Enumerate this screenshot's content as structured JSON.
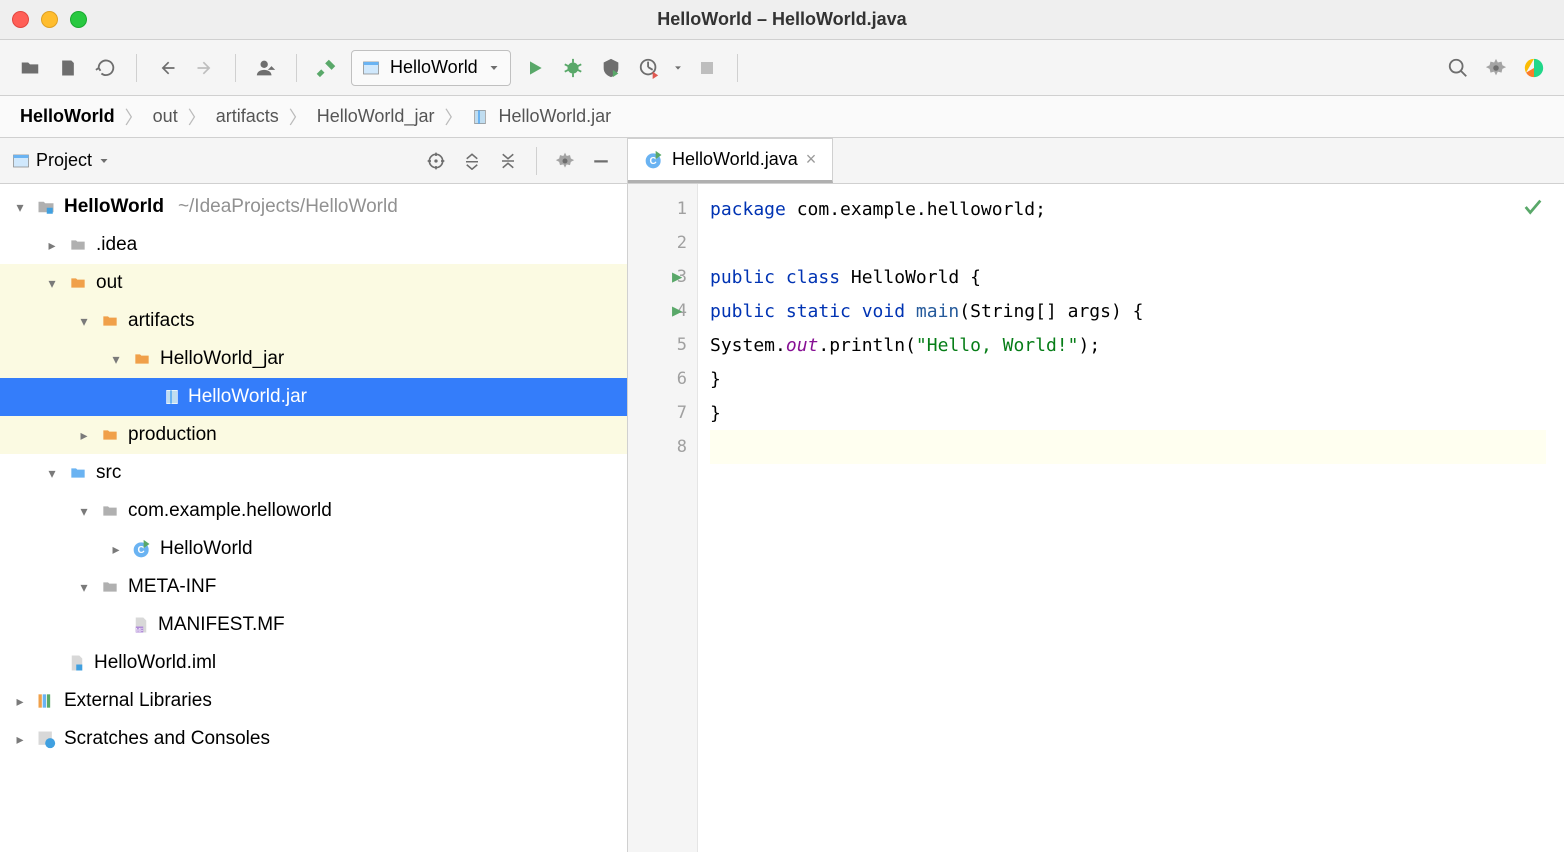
{
  "window": {
    "title": "HelloWorld – HelloWorld.java"
  },
  "toolbar": {
    "run_config": "HelloWorld"
  },
  "breadcrumbs": [
    "HelloWorld",
    "out",
    "artifacts",
    "HelloWorld_jar",
    "HelloWorld.jar"
  ],
  "sidebar": {
    "view_label": "Project"
  },
  "tree": {
    "project": {
      "name": "HelloWorld",
      "path": "~/IdeaProjects/HelloWorld"
    },
    "idea": ".idea",
    "out": "out",
    "artifacts": "artifacts",
    "hw_jar": "HelloWorld_jar",
    "jar": "HelloWorld.jar",
    "production": "production",
    "src": "src",
    "pkg": "com.example.helloworld",
    "cls": "HelloWorld",
    "metainf": "META-INF",
    "manifest": "MANIFEST.MF",
    "iml": "HelloWorld.iml",
    "ext": "External Libraries",
    "scratches": "Scratches and Consoles"
  },
  "editor": {
    "tab": "HelloWorld.java",
    "lines": [
      "1",
      "2",
      "3",
      "4",
      "5",
      "6",
      "7",
      "8"
    ],
    "code": {
      "l1_kw": "package ",
      "l1_id": "com.example.helloworld;",
      "l3_pub": "public class ",
      "l3_cls": "HelloWorld {",
      "l4_pub": "public static void ",
      "l4_main": "main",
      "l4_args": "(String[] args) {",
      "l5_sys": "System.",
      "l5_out": "out",
      "l5_println": ".println(",
      "l5_str": "\"Hello, World!\"",
      "l5_end": ");",
      "l6": "}",
      "l7": "}"
    }
  }
}
